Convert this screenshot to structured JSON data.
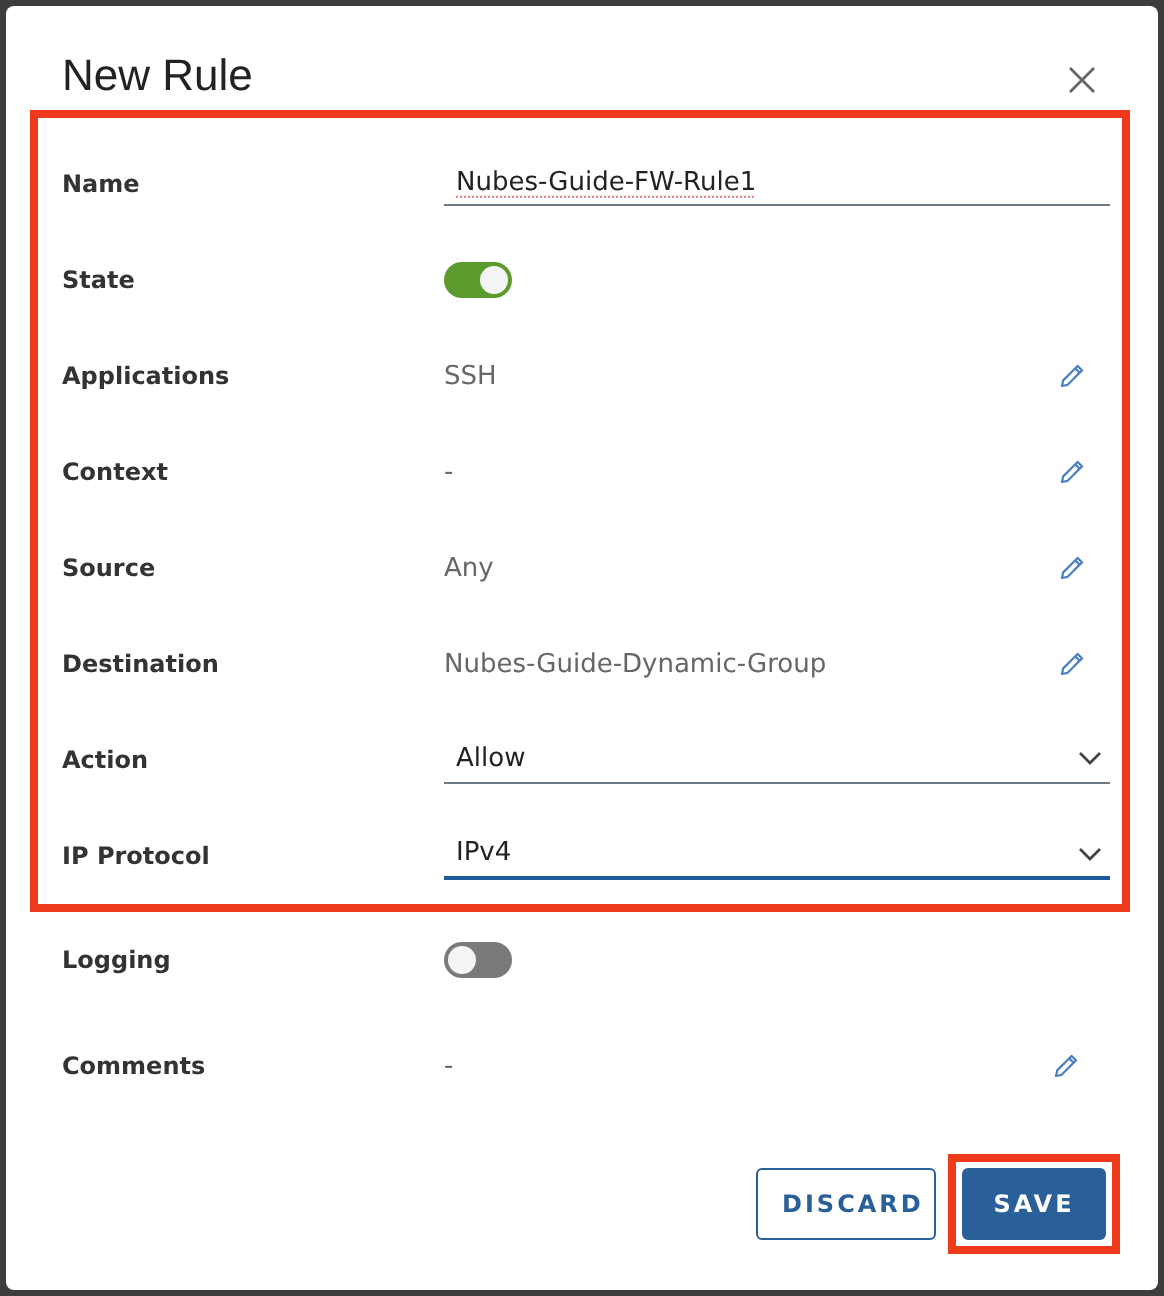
{
  "dialog": {
    "title": "New Rule"
  },
  "sections": [
    {
      "highlighted": true,
      "rows": [
        {
          "label": "Name",
          "kind": "input",
          "value": "Nubes-Guide-FW-Rule1"
        },
        {
          "label": "State",
          "kind": "toggle",
          "on": true
        },
        {
          "label": "Applications",
          "kind": "editable",
          "value": "SSH"
        },
        {
          "label": "Context",
          "kind": "editable",
          "value": "-"
        },
        {
          "label": "Source",
          "kind": "editable",
          "value": "Any"
        },
        {
          "label": "Destination",
          "kind": "editable",
          "value": "Nubes-Guide-Dynamic-Group"
        },
        {
          "label": "Action",
          "kind": "select",
          "value": "Allow",
          "focused": false
        },
        {
          "label": "IP Protocol",
          "kind": "select",
          "value": "IPv4",
          "focused": true
        }
      ]
    },
    {
      "highlighted": false,
      "rows": [
        {
          "label": "Logging",
          "kind": "toggle",
          "on": false
        },
        {
          "label": "Comments",
          "kind": "editable",
          "value": "-"
        }
      ]
    }
  ],
  "buttons": [
    {
      "label": "DISCARD",
      "kind": "outline",
      "highlighted": false
    },
    {
      "label": "SAVE",
      "kind": "primary",
      "highlighted": true
    }
  ]
}
